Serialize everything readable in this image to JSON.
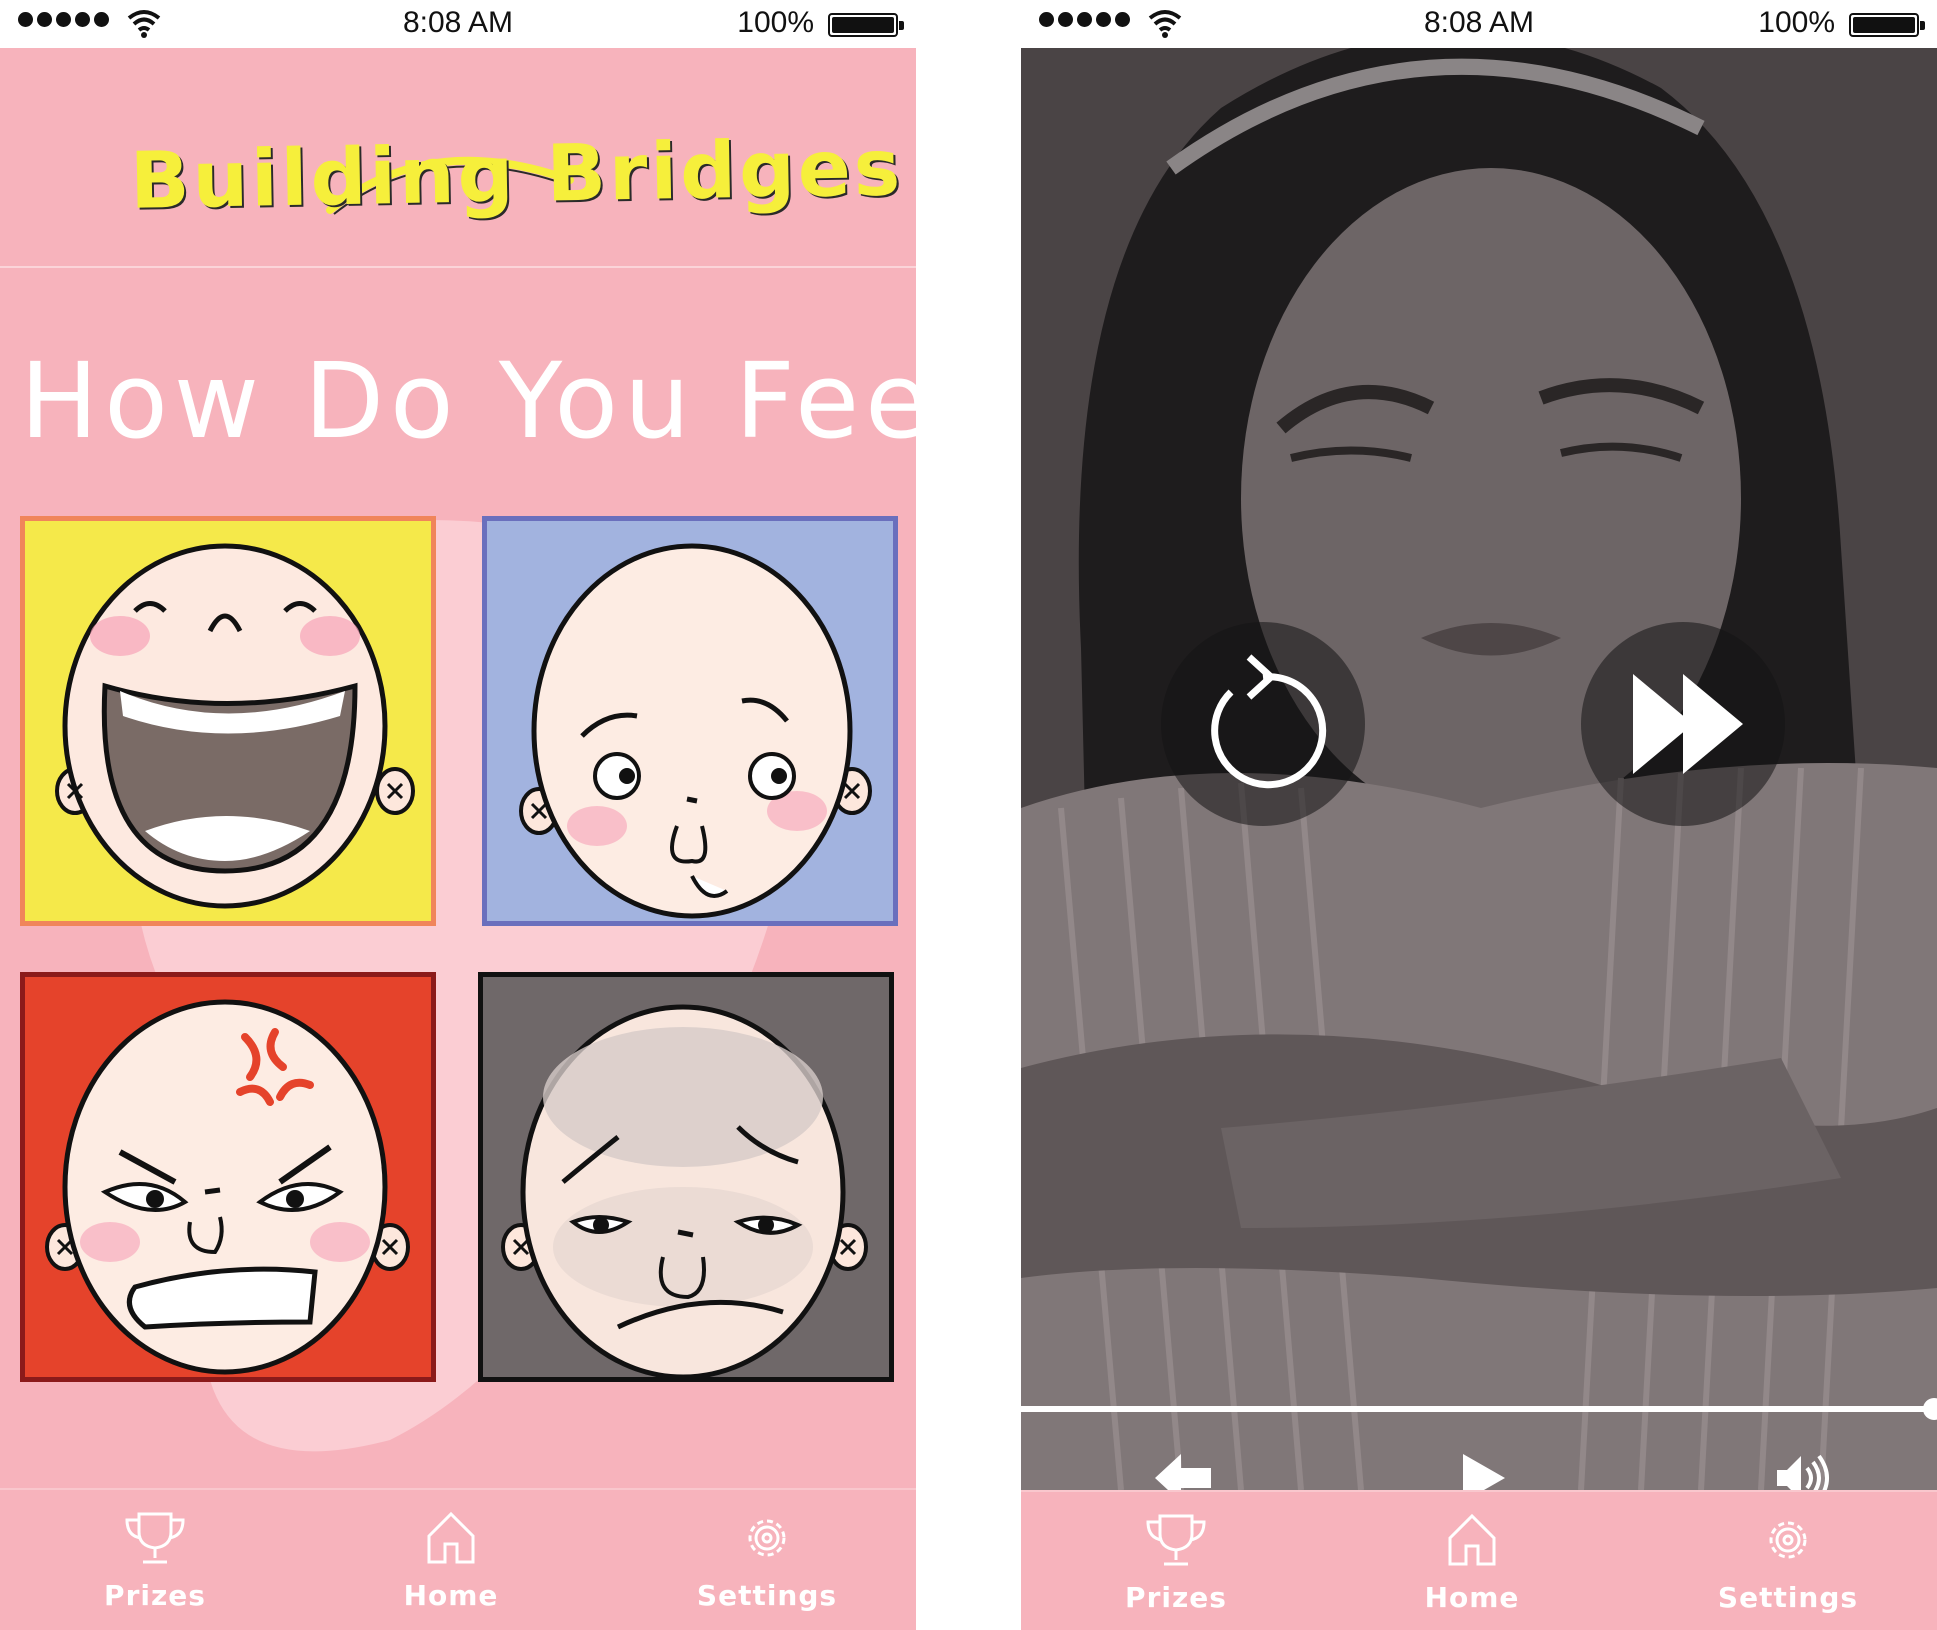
{
  "status_bar": {
    "time": "8:08 AM",
    "battery": "100%"
  },
  "left_screen": {
    "app_title": "Building Bridges",
    "prompt": "How Do You Feel?",
    "emotions": [
      {
        "name": "happy",
        "color": "#f5e94a",
        "border": "#f0855a"
      },
      {
        "name": "worried",
        "color": "#a2b3df",
        "border": "#6a6fbd"
      },
      {
        "name": "angry",
        "color": "#e5432b",
        "border": "#8b1a1a"
      },
      {
        "name": "sad",
        "color": "#6f6869",
        "border": "#111111"
      }
    ]
  },
  "right_screen": {
    "video_progress": 1.0,
    "overlay_controls": [
      "replay-icon",
      "fast-forward-icon"
    ],
    "player_controls": [
      "back-arrow-icon",
      "play-icon",
      "volume-icon"
    ]
  },
  "tabbar": {
    "prizes": "Prizes",
    "home": "Home",
    "settings": "Settings"
  },
  "colors": {
    "background": "#f7b3bc",
    "title": "#f6ef3b",
    "text": "#ffffff"
  }
}
